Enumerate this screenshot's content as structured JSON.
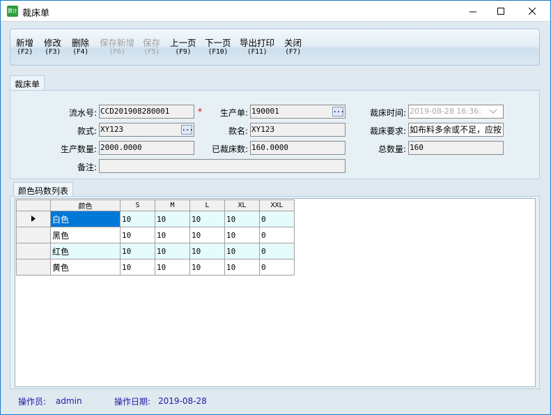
{
  "window": {
    "title": "裁床单",
    "app_icon_text": "算计"
  },
  "toolbar": [
    {
      "label": "新增",
      "shortcut": "(F2)",
      "enabled": true
    },
    {
      "label": "修改",
      "shortcut": "(F3)",
      "enabled": true
    },
    {
      "label": "删除",
      "shortcut": "(F4)",
      "enabled": true
    },
    {
      "label": "保存新增",
      "shortcut": "(F6)",
      "enabled": false
    },
    {
      "label": "保存",
      "shortcut": "(F5)",
      "enabled": false
    },
    {
      "label": "上一页",
      "shortcut": "(F9)",
      "enabled": true
    },
    {
      "label": "下一页",
      "shortcut": "(F10)",
      "enabled": true
    },
    {
      "label": "导出打印",
      "shortcut": "(F11)",
      "enabled": true
    },
    {
      "label": "关闭",
      "shortcut": "(F7)",
      "enabled": true
    }
  ],
  "form_tab": "裁床单",
  "form": {
    "serial_label": "流水号:",
    "serial_value": "CCD201908280001",
    "required_mark": "*",
    "order_label": "生产单:",
    "order_value": "190001",
    "cut_time_label": "裁床时间:",
    "cut_time_value": "2019-08-28 16:36:",
    "style_label": "款式:",
    "style_value": "XY123",
    "style_name_label": "款名:",
    "style_name_value": "XY123",
    "requirement_label": "裁床要求:",
    "requirement_value": "如布料多余或不足，应按",
    "prod_qty_label": "生产数量:",
    "prod_qty_value": "2000.0000",
    "cut_qty_label": "已裁床数:",
    "cut_qty_value": "160.0000",
    "total_label": "总数量:",
    "total_value": "160",
    "remark_label": "备注:",
    "remark_value": "",
    "ellipsis": "..."
  },
  "grid_tab": "颜色码数列表",
  "grid": {
    "columns": [
      "颜色",
      "S",
      "M",
      "L",
      "XL",
      "XXL"
    ],
    "rows": [
      [
        "白色",
        "10",
        "10",
        "10",
        "10",
        "0"
      ],
      [
        "黑色",
        "10",
        "10",
        "10",
        "10",
        "0"
      ],
      [
        "红色",
        "10",
        "10",
        "10",
        "10",
        "0"
      ],
      [
        "黄色",
        "10",
        "10",
        "10",
        "10",
        "0"
      ]
    ]
  },
  "status": {
    "operator_label": "操作员:",
    "operator_value": "admin",
    "date_label": "操作日期:",
    "date_value": "2019-08-28"
  }
}
